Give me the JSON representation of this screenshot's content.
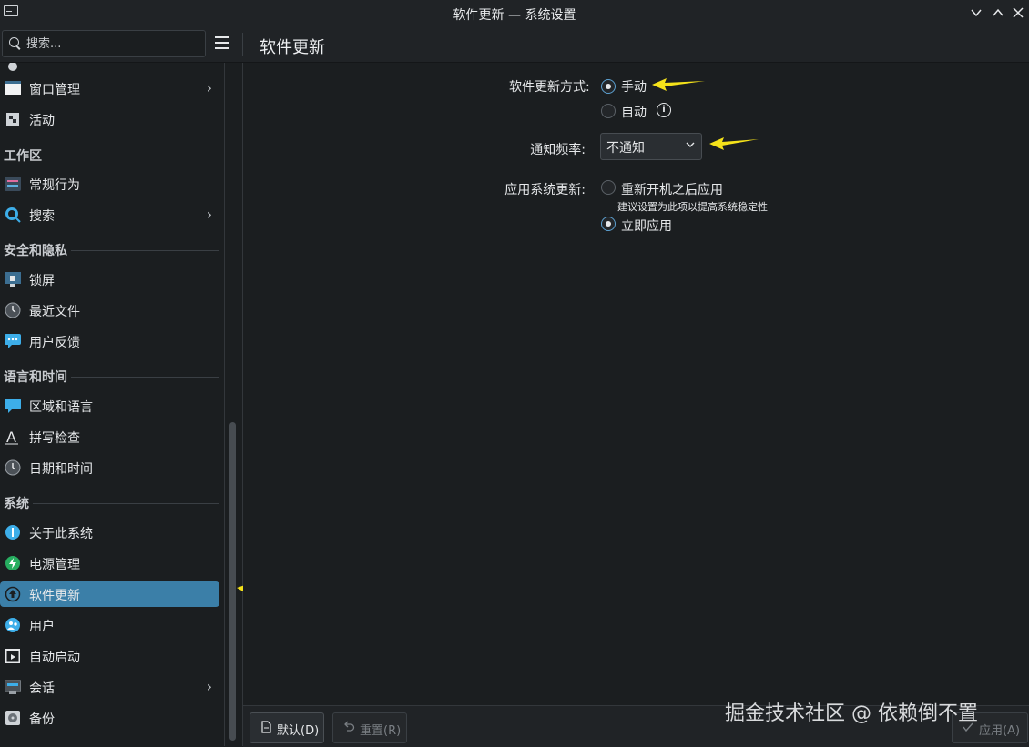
{
  "window": {
    "title": "软件更新 — 系统设置"
  },
  "search": {
    "placeholder": "搜索..."
  },
  "page": {
    "title": "软件更新"
  },
  "sidebar": {
    "items_top": [
      {
        "label": "窗口管理",
        "has_children": true,
        "icon": "window-icon"
      },
      {
        "label": "活动",
        "has_children": false,
        "icon": "activities-icon"
      }
    ],
    "sections": [
      {
        "title": "工作区",
        "items": [
          {
            "label": "常规行为",
            "has_children": false,
            "icon": "general-behavior-icon"
          },
          {
            "label": "搜索",
            "has_children": true,
            "icon": "search-icon"
          }
        ]
      },
      {
        "title": "安全和隐私",
        "items": [
          {
            "label": "锁屏",
            "has_children": false,
            "icon": "lock-screen-icon"
          },
          {
            "label": "最近文件",
            "has_children": false,
            "icon": "recent-files-icon"
          },
          {
            "label": "用户反馈",
            "has_children": false,
            "icon": "feedback-icon"
          }
        ]
      },
      {
        "title": "语言和时间",
        "items": [
          {
            "label": "区域和语言",
            "has_children": false,
            "icon": "region-icon"
          },
          {
            "label": "拼写检查",
            "has_children": false,
            "icon": "spellcheck-icon"
          },
          {
            "label": "日期和时间",
            "has_children": false,
            "icon": "clock-icon"
          }
        ]
      },
      {
        "title": "系统",
        "items": [
          {
            "label": "关于此系统",
            "has_children": false,
            "icon": "info-icon"
          },
          {
            "label": "电源管理",
            "has_children": false,
            "icon": "power-icon"
          },
          {
            "label": "软件更新",
            "has_children": false,
            "icon": "update-icon",
            "selected": true
          },
          {
            "label": "用户",
            "has_children": false,
            "icon": "users-icon"
          },
          {
            "label": "自动启动",
            "has_children": false,
            "icon": "autostart-icon"
          },
          {
            "label": "会话",
            "has_children": true,
            "icon": "session-icon"
          },
          {
            "label": "备份",
            "has_children": false,
            "icon": "backup-icon"
          }
        ]
      }
    ]
  },
  "settings": {
    "update_mode": {
      "label": "软件更新方式:",
      "options": [
        "手动",
        "自动"
      ],
      "selected": "手动"
    },
    "notify_frequency": {
      "label": "通知频率:",
      "value": "不通知"
    },
    "apply_updates": {
      "label": "应用系统更新:",
      "option_reboot": "重新开机之后应用",
      "hint": "建议设置为此项以提高系统稳定性",
      "option_now": "立即应用",
      "selected": "立即应用"
    }
  },
  "footer": {
    "defaults_label": "默认(D)",
    "reset_label": "重置(R)",
    "apply_label": "应用(A)"
  },
  "watermark": "掘金技术社区 @ 依赖倒不置",
  "colors": {
    "accent": "#3b7fa8",
    "annotation_arrow": "#f5e21a",
    "background": "#1b1e20"
  }
}
